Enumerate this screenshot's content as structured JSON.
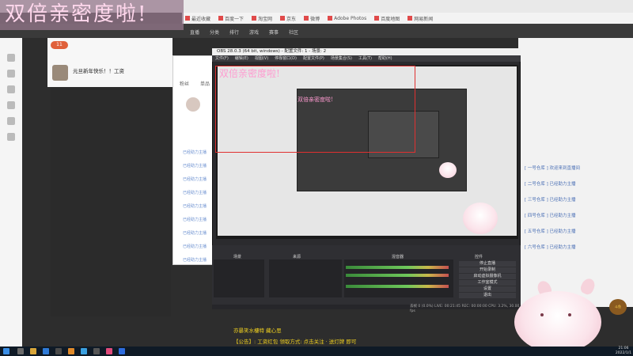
{
  "title_overlay": "双倍亲密度啦!",
  "nested_title": "双倍亲密度啦!",
  "bookmarks": [
    "最近收藏",
    "百度一下",
    "淘宝网",
    "京东",
    "微博",
    "Adobe Photos",
    "百度地图",
    "网易新闻"
  ],
  "site_nav": [
    "直播",
    "分类",
    "排行",
    "游戏",
    "赛事",
    "社区"
  ],
  "stream": {
    "streamer_name": "元旦新年快乐！！工资",
    "level": "11",
    "tab_fans": "粉丝",
    "tab_gift": "单品"
  },
  "popup_rows": [
    "已经助力主播",
    "已经助力主播",
    "已经助力主播",
    "已经助力主播",
    "已经助力主播",
    "已经助力主播",
    "已经助力主播",
    "已经助力主播",
    "已经助力主播"
  ],
  "obs": {
    "window_title": "OBS 28.0.3 (64 bit, windows) - 配置文件: 1 - 场景: 2",
    "menu": [
      "文件(F)",
      "编辑(E)",
      "视图(V)",
      "停靠窗口(D)",
      "配置文件(P)",
      "场景集合(S)",
      "工具(T)",
      "帮助(H)"
    ],
    "docks": [
      "场景",
      "来源",
      "混音器",
      "场景转换",
      "控件"
    ],
    "controls": [
      "停止直播",
      "开始录制",
      "启动虚拟摄像机",
      "工作室模式",
      "设置",
      "退出"
    ],
    "status": "丢帧 0 (0.0%)   LIVE: 00:21:45   REC: 00:00:00   CPU: 3.2%, 30.00 fps"
  },
  "right_panel": [
    "[ 一号仓库 ] 欢迎来到直播间",
    "[ 二号仓库 ] 已经助力主播",
    "[ 三号仓库 ] 已经助力主播",
    "[ 四号仓库 ] 已经助力主播",
    "[ 五号仓库 ] 已经助力主播",
    "[ 六号仓库 ] 已经助力主播"
  ],
  "captions": {
    "line1": "亦暴笑水樓特 藏心思",
    "line2": "【公告】: 工资红包 领取方式: 点击关注 · 送灯牌 即可"
  },
  "clock": {
    "time": "21:06",
    "date": "2022/1/1"
  },
  "corner_logo": "斗鱼"
}
